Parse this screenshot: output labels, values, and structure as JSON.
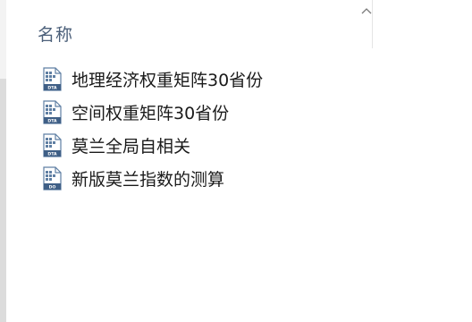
{
  "header": {
    "name_column": "名称",
    "sort_icon": "chevron-up-icon"
  },
  "files": [
    {
      "name": "地理经济权重矩阵30省份",
      "icon": "stata-data-file-icon",
      "badge": "DTA"
    },
    {
      "name": "空间权重矩阵30省份",
      "icon": "stata-data-file-icon",
      "badge": "DTA"
    },
    {
      "name": "莫兰全局自相关",
      "icon": "stata-data-file-icon",
      "badge": "DTA"
    },
    {
      "name": "新版莫兰指数的测算",
      "icon": "stata-do-file-icon",
      "badge": "DO"
    }
  ],
  "colors": {
    "header_text": "#4c607a",
    "icon_page": "#5f7fa3",
    "icon_badge": "#3f5f86"
  }
}
